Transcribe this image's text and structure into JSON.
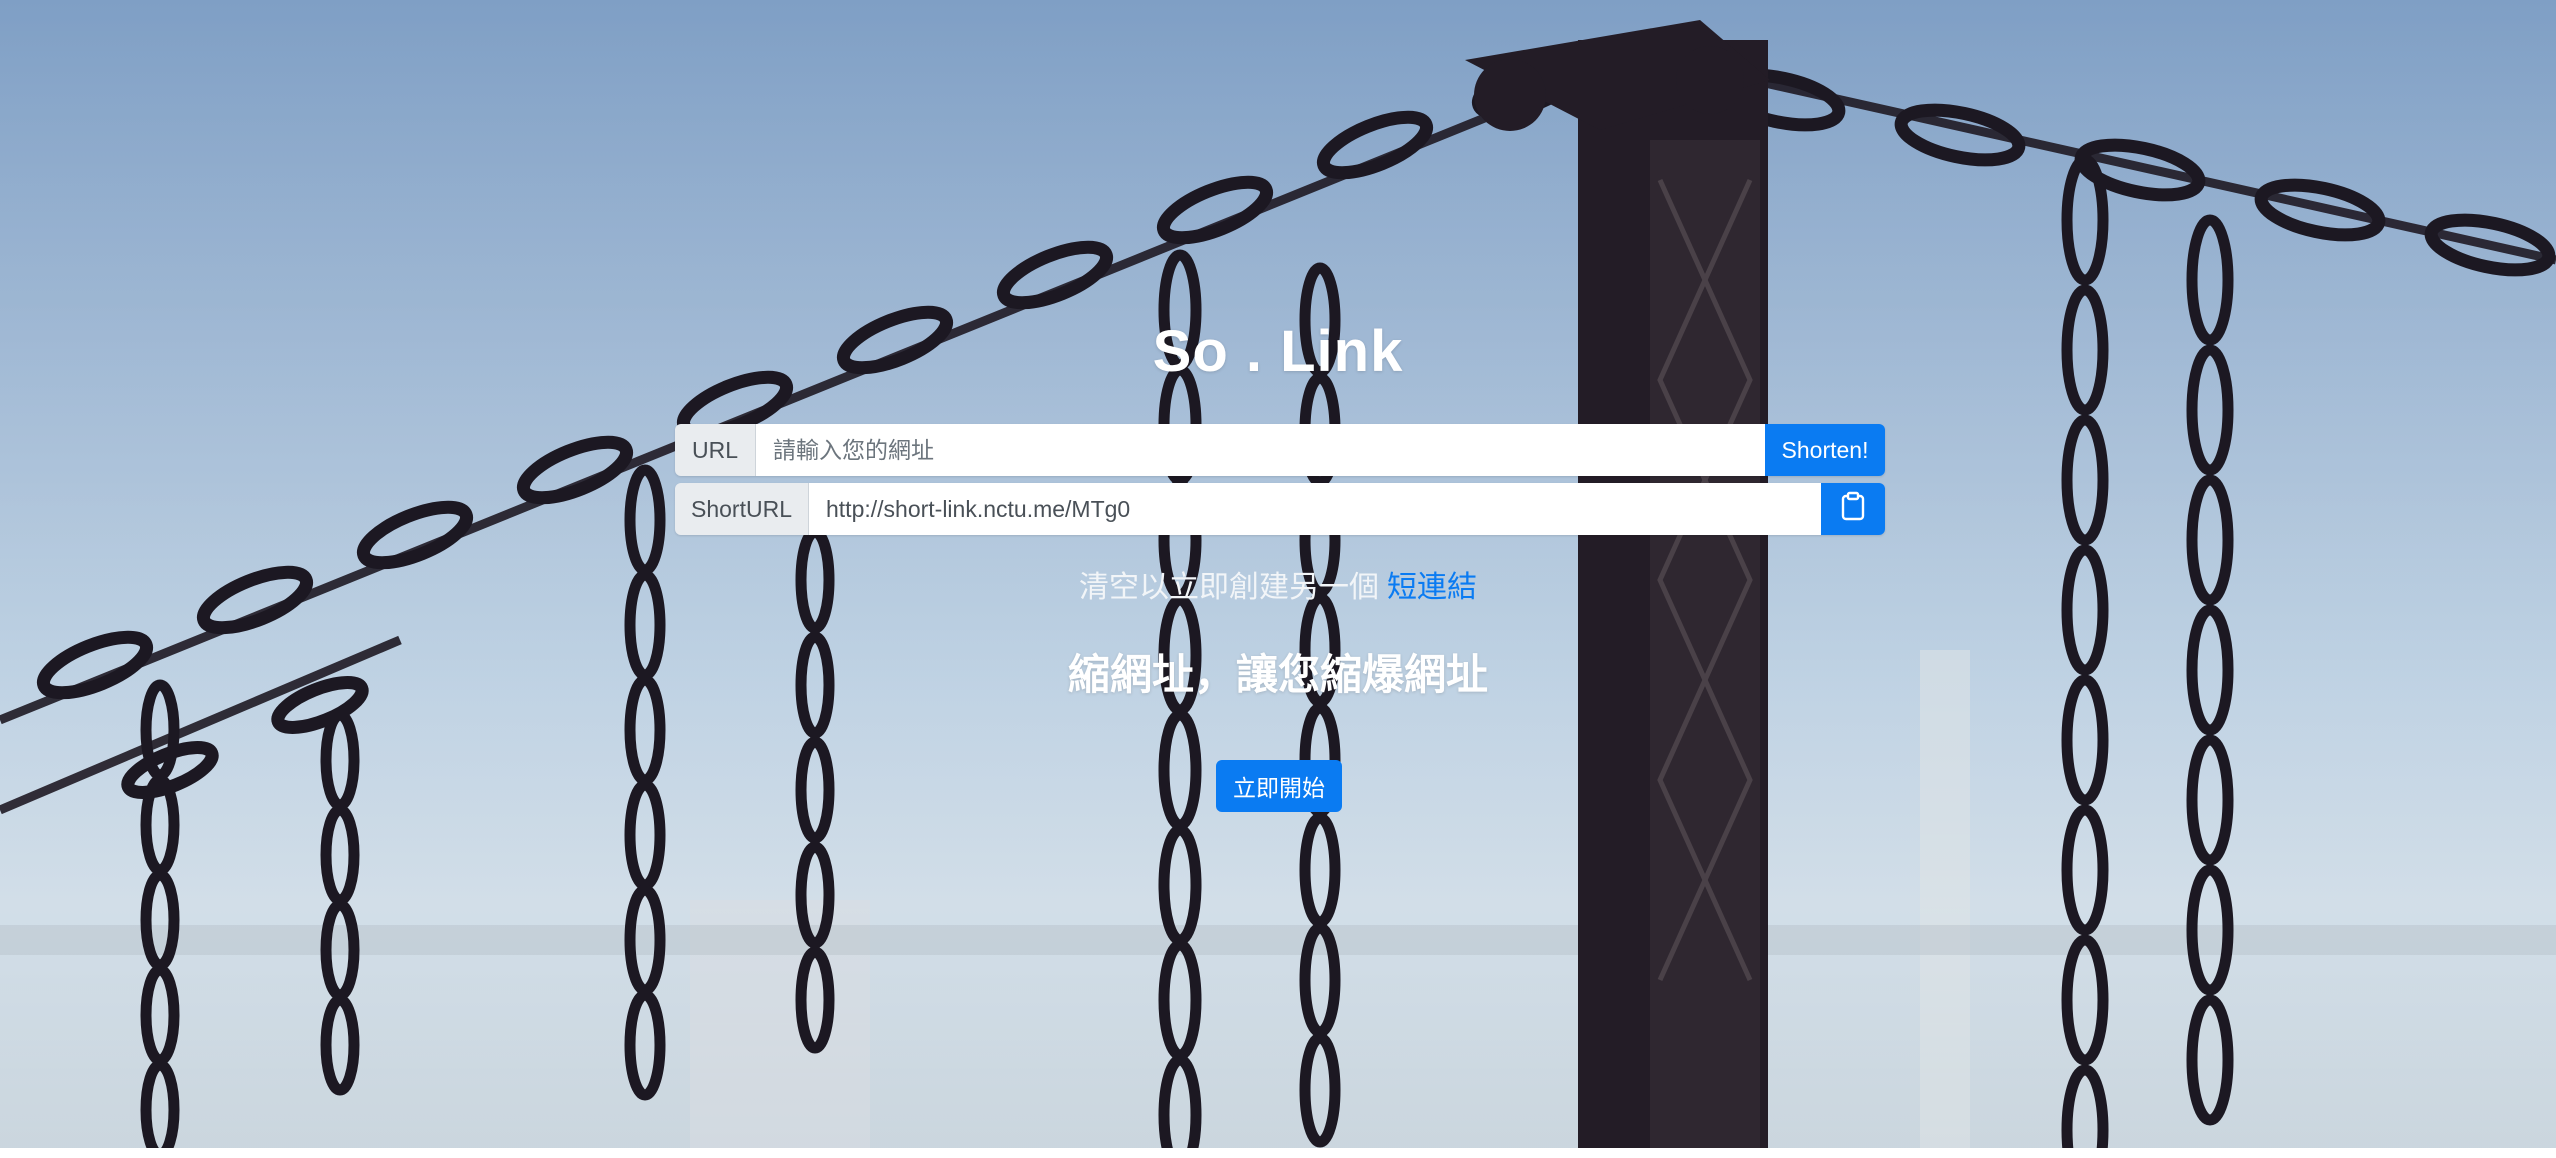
{
  "brand": {
    "title": "So . Link"
  },
  "url_group": {
    "label": "URL",
    "placeholder": "請輸入您的網址",
    "value": "",
    "button_label": "Shorten!"
  },
  "short_group": {
    "label": "ShortURL",
    "value": "http://short-link.nctu.me/MTg0",
    "copy_icon": "clipboard-icon"
  },
  "clear_line": {
    "text": "清空以立即創建另一個",
    "link_label": "短連結"
  },
  "slogan": "縮網址，讓您縮爆網址",
  "start_button_label": "立即開始",
  "colors": {
    "primary": "#0a7bf2",
    "addon_bg": "#e9ecef"
  }
}
